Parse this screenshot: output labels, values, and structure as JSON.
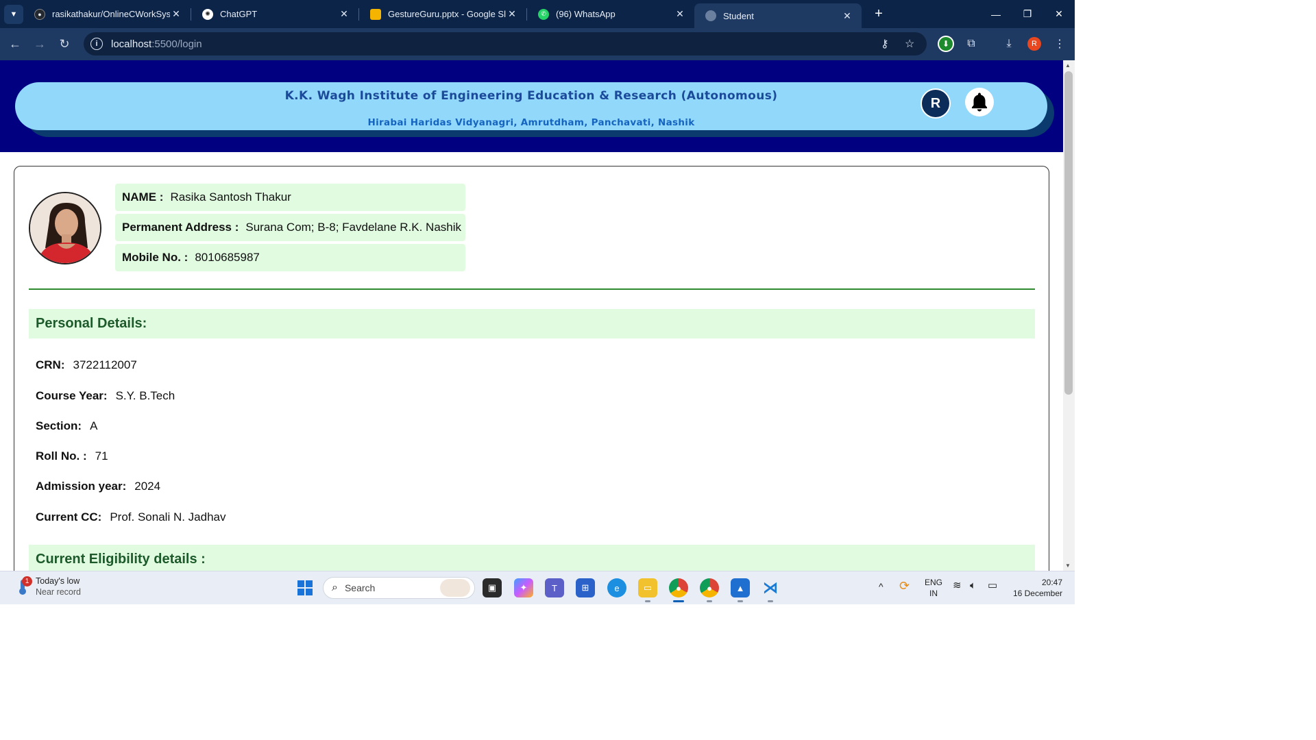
{
  "browser": {
    "tabs": [
      {
        "title": "rasikathakur/OnlineCWorkSyste",
        "icon": "github-icon"
      },
      {
        "title": "ChatGPT",
        "icon": "chatgpt-icon"
      },
      {
        "title": "GestureGuru.pptx - Google Slid",
        "icon": "slides-icon"
      },
      {
        "title": "(96) WhatsApp",
        "icon": "whatsapp-icon"
      },
      {
        "title": "Student",
        "icon": "globe-icon"
      }
    ],
    "url_host": "localhost",
    "url_rest": ":5500/login",
    "profile_letter": "R"
  },
  "header": {
    "institute": "K.K. Wagh Institute of Engineering Education & Research (Autonomous)",
    "address": "Hirabai Haridas Vidyanagri, Amrutdham, Panchavati, Nashik",
    "avatar_letter": "R"
  },
  "profile": {
    "name_label": "NAME :",
    "name": "Rasika Santosh Thakur",
    "address_label": "Permanent Address :",
    "address": "Surana Com; B-8; Favdelane R.K. Nashik",
    "mobile_label": "Mobile No. :",
    "mobile": "8010685987"
  },
  "personal": {
    "heading": "Personal Details:",
    "crn_label": "CRN:",
    "crn": "3722112007",
    "course_label": "Course Year:",
    "course": "S.Y. B.Tech",
    "section_label": "Section:",
    "section": "A",
    "roll_label": "Roll No. :",
    "roll": "71",
    "admission_label": "Admission year:",
    "admission": "2024",
    "cc_label": "Current CC:",
    "cc": "Prof. Sonali N. Jadhav"
  },
  "eligibility": {
    "heading": "Current Eligibility details :"
  },
  "taskbar": {
    "weather_title": "Today's low",
    "weather_sub": "Near record",
    "weather_badge": "1",
    "search_placeholder": "Search",
    "lang1": "ENG",
    "lang2": "IN",
    "time": "20:47",
    "date": "16 December"
  },
  "colors": {
    "banner": "#000080",
    "pill": "#91d8fb",
    "section_bg": "#e1fbe1",
    "section_text": "#1d5a2a"
  }
}
